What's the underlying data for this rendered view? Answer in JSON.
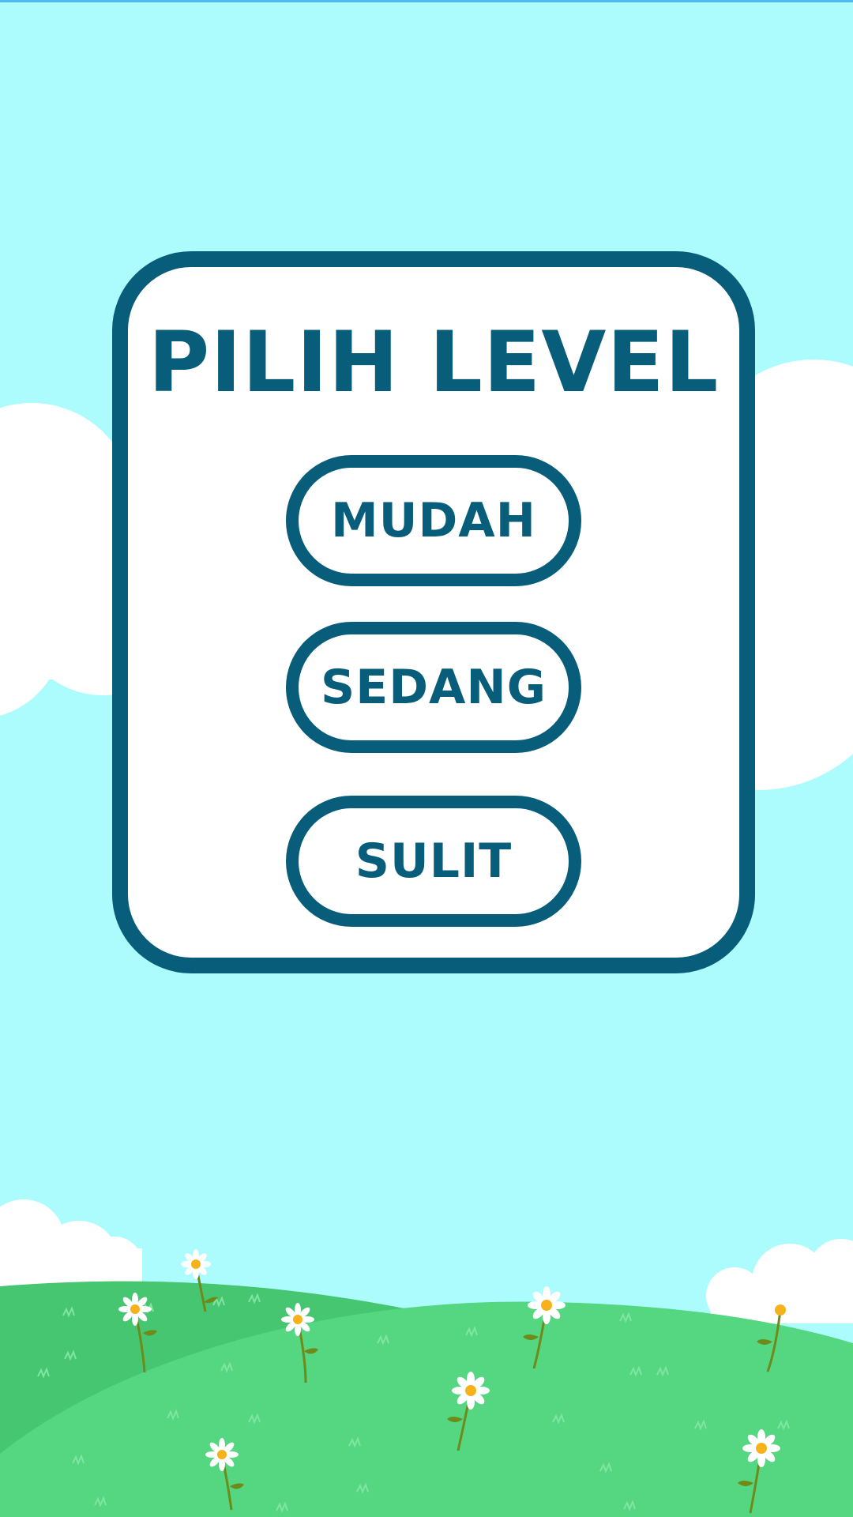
{
  "screen": {
    "title": "PILIH LEVEL"
  },
  "levels": [
    {
      "label": "MUDAH"
    },
    {
      "label": "SEDANG"
    },
    {
      "label": "SULIT"
    }
  ],
  "colors": {
    "sky": "#adfcfd",
    "accent": "#075d7a",
    "panel": "#ffffff",
    "cloud": "#ffffff",
    "grass_light": "#55d681",
    "grass_dark": "#46c670",
    "flower_petal": "#ffffff",
    "flower_center": "#f6b21b"
  },
  "icons": [
    "cloud-icon",
    "daisy-flower-icon",
    "grass-tuft-icon"
  ]
}
